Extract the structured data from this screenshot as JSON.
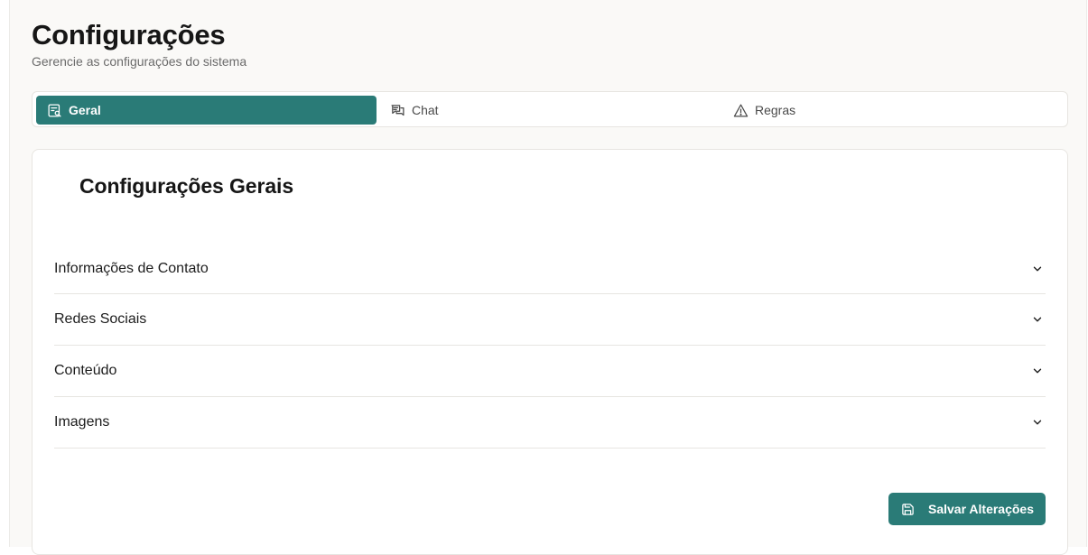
{
  "header": {
    "title": "Configurações",
    "subtitle": "Gerencie as configurações do sistema"
  },
  "tabs": [
    {
      "label": "Geral",
      "icon": "list-settings-icon",
      "active": true
    },
    {
      "label": "Chat",
      "icon": "chat-bubbles-icon",
      "active": false
    },
    {
      "label": "Regras",
      "icon": "warning-triangle-icon",
      "active": false
    }
  ],
  "card": {
    "title": "Configurações Gerais",
    "sections": [
      {
        "label": "Informações de Contato",
        "icon": "chevron-down-icon"
      },
      {
        "label": "Redes Sociais",
        "icon": "chevron-down-icon"
      },
      {
        "label": "Conteúdo",
        "icon": "chevron-down-icon"
      },
      {
        "label": "Imagens",
        "icon": "chevron-down-icon"
      }
    ],
    "save_label": "Salvar Alterações",
    "save_icon": "floppy-disk-icon"
  },
  "colors": {
    "accent": "#2a7b77",
    "background": "#faf9f7",
    "border": "#e7e5e1",
    "text": "#1c1c1c",
    "muted": "#6b6b6b"
  }
}
